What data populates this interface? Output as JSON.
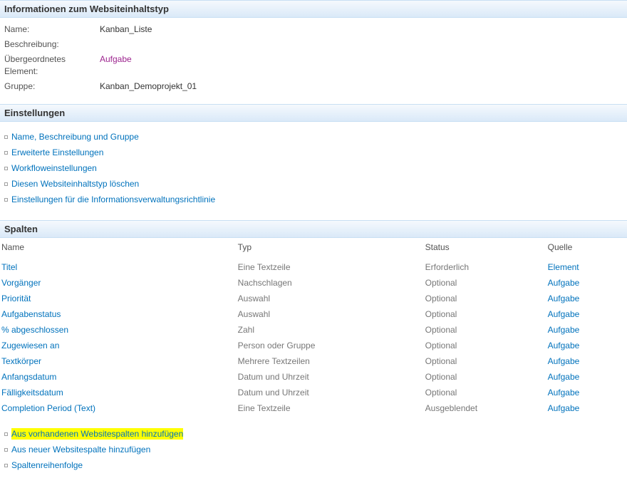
{
  "sections": {
    "info_header": "Informationen zum Websiteinhaltstyp",
    "settings_header": "Einstellungen",
    "columns_header": "Spalten"
  },
  "info": {
    "labels": {
      "name": "Name:",
      "description": "Beschreibung:",
      "parent": "Übergeordnetes Element:",
      "group": "Gruppe:"
    },
    "values": {
      "name": "Kanban_Liste",
      "description": "",
      "parent": "Aufgabe",
      "group": "Kanban_Demoprojekt_01"
    }
  },
  "settings_links": [
    "Name, Beschreibung und Gruppe",
    "Erweiterte Einstellungen",
    "Workfloweinstellungen",
    "Diesen Websiteinhaltstyp löschen",
    "Einstellungen für die Informationsverwaltungsrichtlinie"
  ],
  "columns": {
    "headers": {
      "name": "Name",
      "type": "Typ",
      "status": "Status",
      "source": "Quelle"
    },
    "rows": [
      {
        "name": "Titel",
        "type": "Eine Textzeile",
        "status": "Erforderlich",
        "source": "Element"
      },
      {
        "name": "Vorgänger",
        "type": "Nachschlagen",
        "status": "Optional",
        "source": "Aufgabe"
      },
      {
        "name": "Priorität",
        "type": "Auswahl",
        "status": "Optional",
        "source": "Aufgabe"
      },
      {
        "name": "Aufgabenstatus",
        "type": "Auswahl",
        "status": "Optional",
        "source": "Aufgabe"
      },
      {
        "name": "% abgeschlossen",
        "type": "Zahl",
        "status": "Optional",
        "source": "Aufgabe"
      },
      {
        "name": "Zugewiesen an",
        "type": "Person oder Gruppe",
        "status": "Optional",
        "source": "Aufgabe"
      },
      {
        "name": "Textkörper",
        "type": "Mehrere Textzeilen",
        "status": "Optional",
        "source": "Aufgabe"
      },
      {
        "name": "Anfangsdatum",
        "type": "Datum und Uhrzeit",
        "status": "Optional",
        "source": "Aufgabe"
      },
      {
        "name": "Fälligkeitsdatum",
        "type": "Datum und Uhrzeit",
        "status": "Optional",
        "source": "Aufgabe"
      },
      {
        "name": "Completion Period (Text)",
        "type": "Eine Textzeile",
        "status": "Ausgeblendet",
        "source": "Aufgabe"
      }
    ]
  },
  "column_actions": [
    {
      "label": "Aus vorhandenen Websitespalten hinzufügen",
      "highlight": true
    },
    {
      "label": "Aus neuer Websitespalte hinzufügen",
      "highlight": false
    },
    {
      "label": "Spaltenreihenfolge",
      "highlight": false
    }
  ]
}
